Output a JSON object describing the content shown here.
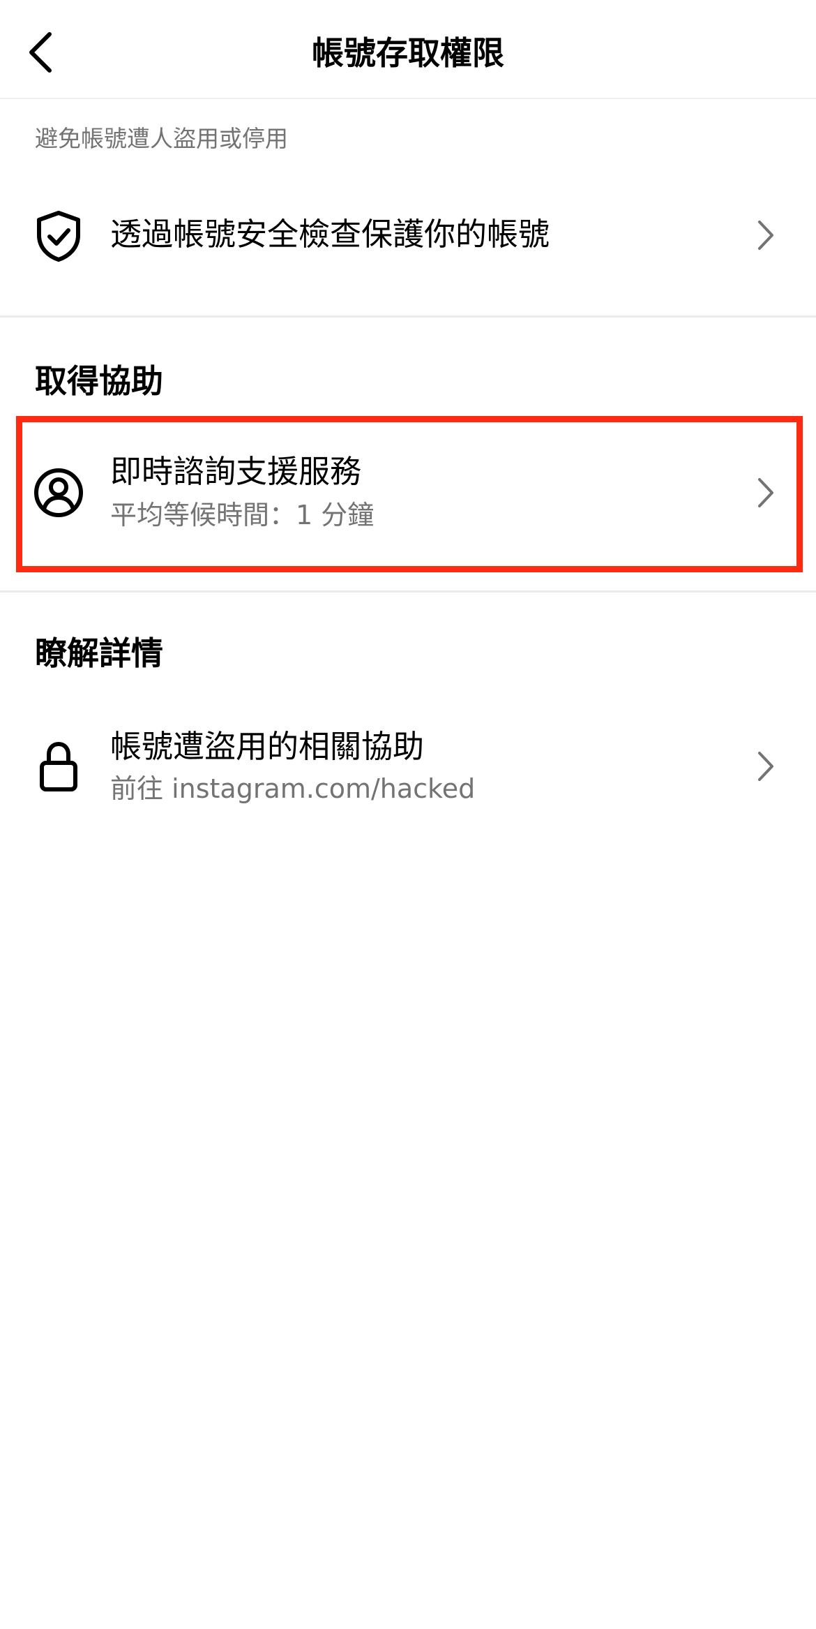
{
  "header": {
    "title": "帳號存取權限",
    "back_icon": "chevron-left-icon"
  },
  "intro": {
    "caption": "避免帳號遭人盜用或停用",
    "security_check": {
      "icon": "shield-check-icon",
      "label": "透過帳號安全檢查保護你的帳號"
    }
  },
  "get_help": {
    "section_title": "取得協助",
    "live_chat": {
      "icon": "user-circle-icon",
      "label": "即時諮詢支援服務",
      "subtitle": "平均等候時間：1 分鐘"
    }
  },
  "learn_more": {
    "section_title": "瞭解詳情",
    "hacked_help": {
      "icon": "lock-icon",
      "label": "帳號遭盜用的相關協助",
      "subtitle": "前往 instagram.com/hacked"
    }
  },
  "colors": {
    "highlight": "#ff2a12",
    "secondary_text": "#737373",
    "divider": "#ebebeb"
  }
}
